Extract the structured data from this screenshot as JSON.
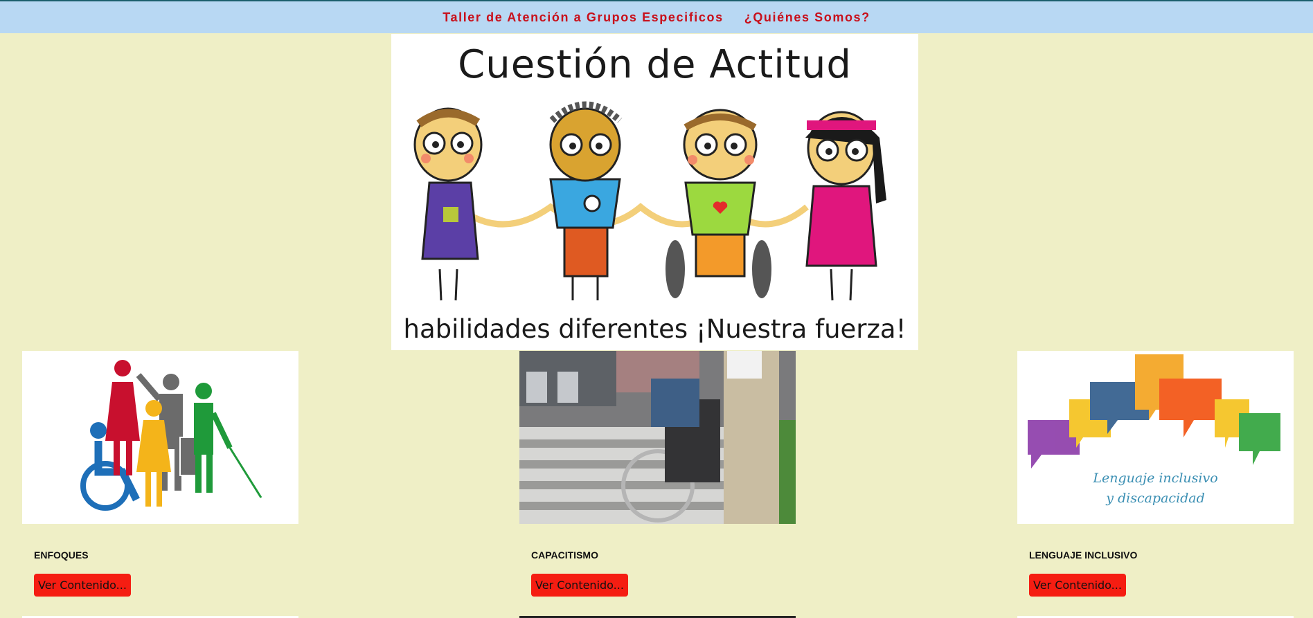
{
  "nav": {
    "items": [
      {
        "label": "Taller de Atención a Grupos Especificos"
      },
      {
        "label": "¿Quiénes Somos?"
      }
    ]
  },
  "hero": {
    "title": "Cuestión de Actitud",
    "tagline": "habilidades diferentes ¡Nuestra fuerza!"
  },
  "cards": [
    {
      "title": "ENFOQUES",
      "button": "Ver Contenido..."
    },
    {
      "title": "CAPACITISMO",
      "button": "Ver Contenido..."
    },
    {
      "title": "LENGUAJE INCLUSIVO",
      "button": "Ver Contenido...",
      "image_text_1": "Lenguaje inclusivo",
      "image_text_2": "y discapacidad"
    }
  ],
  "colors": {
    "page_background": "#efefc6",
    "nav_background": "#b8d8f3",
    "nav_text": "#c8101b",
    "button_background": "#f51d12"
  },
  "icons": [
    "accessibility-people-icon",
    "wheelchair-photo",
    "speech-bubbles-icon"
  ]
}
